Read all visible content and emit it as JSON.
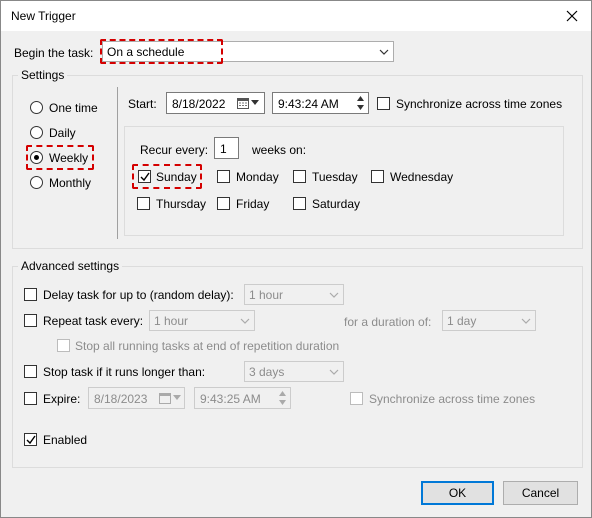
{
  "window": {
    "title": "New Trigger"
  },
  "begin": {
    "label": "Begin the task:",
    "value": "On a schedule"
  },
  "settings": {
    "group_label": "Settings",
    "radios": [
      {
        "label": "One time",
        "selected": false
      },
      {
        "label": "Daily",
        "selected": false
      },
      {
        "label": "Weekly",
        "selected": true
      },
      {
        "label": "Monthly",
        "selected": false
      }
    ],
    "start_label": "Start:",
    "start_date": "8/18/2022",
    "start_time": "9:43:24 AM",
    "sync_label": "Synchronize across time zones",
    "recur_label": "Recur every:",
    "recur_value": "1",
    "weeks_on_label": "weeks on:",
    "days": [
      {
        "label": "Sunday",
        "checked": true
      },
      {
        "label": "Monday",
        "checked": false
      },
      {
        "label": "Tuesday",
        "checked": false
      },
      {
        "label": "Wednesday",
        "checked": false
      },
      {
        "label": "Thursday",
        "checked": false
      },
      {
        "label": "Friday",
        "checked": false
      },
      {
        "label": "Saturday",
        "checked": false
      }
    ]
  },
  "advanced": {
    "group_label": "Advanced settings",
    "delay_label": "Delay task for up to (random delay):",
    "delay_value": "1 hour",
    "repeat_label": "Repeat task every:",
    "repeat_value": "1 hour",
    "duration_label": "for a duration of:",
    "duration_value": "1 day",
    "stop_all_label": "Stop all running tasks at end of repetition duration",
    "stop_longer_label": "Stop task if it runs longer than:",
    "stop_longer_value": "3 days",
    "expire_label": "Expire:",
    "expire_date": "8/18/2023",
    "expire_time": "9:43:25 AM",
    "expire_sync_label": "Synchronize across time zones",
    "enabled_label": "Enabled",
    "enabled_checked": true
  },
  "buttons": {
    "ok": "OK",
    "cancel": "Cancel"
  },
  "colors": {
    "highlight": "#d40000",
    "default_button_border": "#0078d7"
  }
}
